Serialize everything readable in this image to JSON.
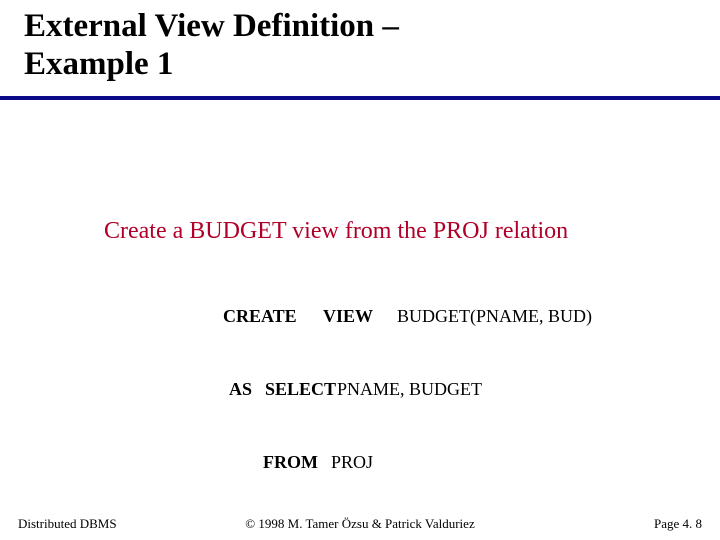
{
  "title": {
    "line1": "External View Definition –",
    "line2": "Example 1"
  },
  "subtitle": "Create a BUDGET view from the PROJ relation",
  "sql": {
    "r1": {
      "kw1": "CREATE",
      "kw2": "VIEW",
      "rest": "BUDGET(PNAME, BUD)"
    },
    "r2": {
      "kw1": "AS",
      "kw2": "SELECT",
      "rest": "PNAME, BUDGET"
    },
    "r3": {
      "kw1": "FROM",
      "rest": "PROJ"
    }
  },
  "footer": {
    "left": "Distributed DBMS",
    "center": "© 1998 M. Tamer Özsu & Patrick Valduriez",
    "right": "Page 4. 8"
  }
}
